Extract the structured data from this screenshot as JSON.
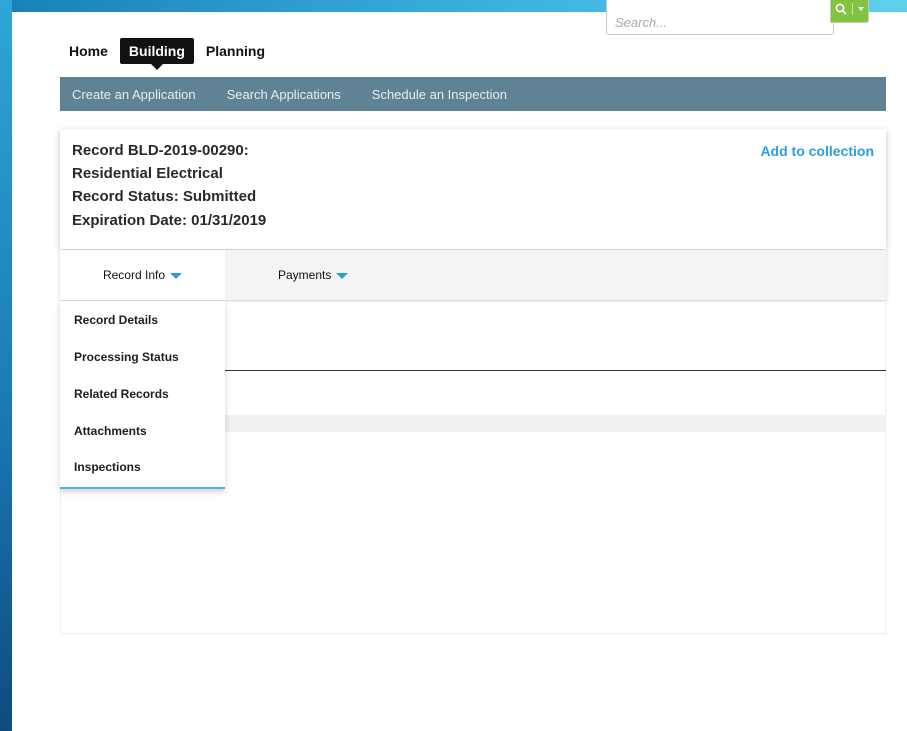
{
  "search": {
    "placeholder": "Search..."
  },
  "topnav": {
    "items": [
      "Home",
      "Building",
      "Planning"
    ],
    "active": "Building"
  },
  "subnav": {
    "items": [
      "Create an Application",
      "Search Applications",
      "Schedule an Inspection"
    ]
  },
  "record": {
    "number_line": "Record BLD-2019-00290:",
    "type_line": "Residential Electrical",
    "status_line": "Record Status: Submitted",
    "expiration_line": "Expiration Date: 01/31/2019",
    "add_to_collection": "Add to collection"
  },
  "tabs": [
    {
      "label": "Record Info",
      "active": true
    },
    {
      "label": "Payments",
      "active": false
    }
  ],
  "dropdown": {
    "items": [
      "Record Details",
      "Processing Status",
      "Related Records",
      "Attachments",
      "Inspections"
    ]
  },
  "colors": {
    "accent": "#2aa0da",
    "subnav_bg": "#5f8394",
    "search_button": "#82c341",
    "frame": "#1f8fc8"
  },
  "icons": {
    "search_button": "search-icon"
  }
}
